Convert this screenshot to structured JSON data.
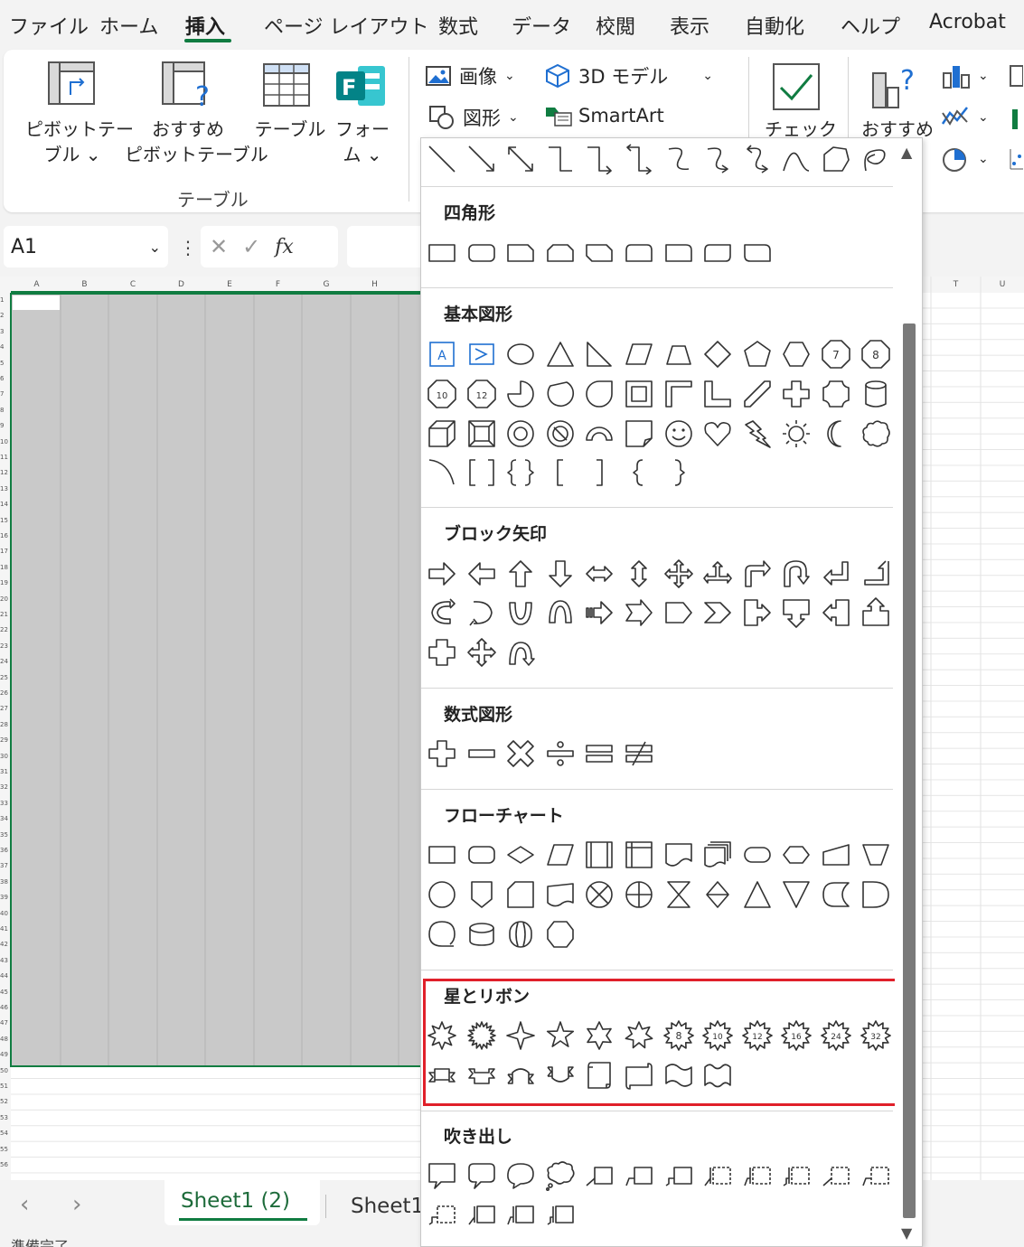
{
  "tabs": [
    {
      "label": "ファイル"
    },
    {
      "label": "ホーム"
    },
    {
      "label": "挿入"
    },
    {
      "label": "ページ レイアウト"
    },
    {
      "label": "数式"
    },
    {
      "label": "データ"
    },
    {
      "label": "校閲"
    },
    {
      "label": "表示"
    },
    {
      "label": "自動化"
    },
    {
      "label": "ヘルプ"
    },
    {
      "label": "Acrobat"
    }
  ],
  "active_tab": "挿入",
  "ribbon": {
    "pivot_table": {
      "line1": "ピボットテー",
      "line2": "ブル ⌄"
    },
    "recommended_pivot": {
      "line1": "おすすめ",
      "line2": "ピボットテーブル"
    },
    "table": {
      "line1": "テーブル"
    },
    "forms": {
      "line1": "フォー",
      "line2": "ム ⌄"
    },
    "tables_group_label": "テーブル",
    "image": "画像",
    "model3d": "3D モデル",
    "shapes": "図形",
    "smartart": "SmartArt",
    "check": "チェック",
    "recommended_charts": "おすすめ"
  },
  "formula_bar": {
    "name_box": "A1",
    "fx": "fx"
  },
  "columns_left": [
    "A",
    "B",
    "C",
    "D",
    "E",
    "F",
    "G",
    "H"
  ],
  "columns_right": [
    "T",
    "U"
  ],
  "sheet_tabs": [
    "Sheet1 (2)",
    "Sheet1"
  ],
  "status": {
    "text": "準備完了"
  },
  "dropdown": {
    "sections": [
      {
        "title": "四角形"
      },
      {
        "title": "基本図形"
      },
      {
        "title": "ブロック矢印"
      },
      {
        "title": "数式図形"
      },
      {
        "title": "フローチャート"
      },
      {
        "title": "星とリボン"
      },
      {
        "title": "吹き出し"
      }
    ],
    "octagon_numbers": [
      "7",
      "8",
      "10",
      "12"
    ],
    "star_numbers": [
      "8",
      "10",
      "12",
      "16",
      "24",
      "32"
    ]
  },
  "colors": {
    "accent": "#107c41",
    "highlight": "#e0202a",
    "selection": "#1f6fd1"
  }
}
